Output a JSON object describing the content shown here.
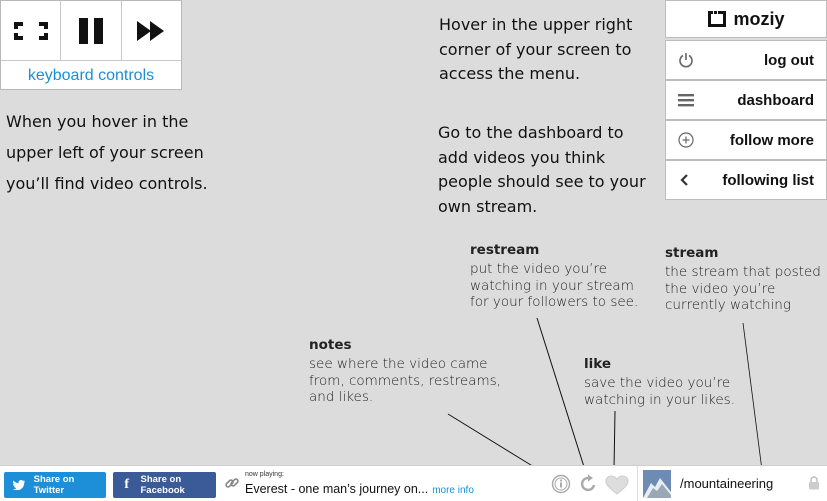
{
  "controls": {
    "keyboard_label": "keyboard controls",
    "fullscreen_icon": "fullscreen-icon",
    "pause_icon": "pause-icon",
    "next_icon": "fast-forward-icon"
  },
  "help": {
    "left_lines": [
      "When you hover in the",
      "upper left of your screen",
      "you’ll find video controls."
    ],
    "menu_lines": [
      "Hover in the upper right",
      "corner of your screen to",
      "access the menu."
    ],
    "dashboard_lines": [
      "Go to the dashboard to",
      "add videos you think",
      "people should see to your",
      "own stream."
    ]
  },
  "menu": {
    "logo_text": "moziy",
    "items": [
      {
        "label": "log out",
        "icon": "power-icon"
      },
      {
        "label": "dashboard",
        "icon": "hamburger-icon"
      },
      {
        "label": "follow more",
        "icon": "plus-circle-icon"
      },
      {
        "label": "following list",
        "icon": "chevron-left-icon"
      }
    ]
  },
  "annotations": {
    "restream": {
      "title": "restream",
      "lines": [
        "put the video you’re",
        "watching in your stream",
        "for your followers to see."
      ]
    },
    "stream": {
      "title": "stream",
      "lines": [
        "the stream that posted",
        "the video you’re",
        "currently watching"
      ]
    },
    "notes": {
      "title": "notes",
      "lines": [
        "see where the video came",
        "from, comments, restreams,",
        "and likes."
      ]
    },
    "like": {
      "title": "like",
      "lines": [
        "save the video you’re",
        "watching in your likes."
      ]
    }
  },
  "bottom": {
    "share_twitter": "Share on Twitter",
    "share_facebook": "Share on Facebook",
    "now_playing_label": "now playing:",
    "now_playing_title": "Everest - one man’s journey on...",
    "more_info": "more info",
    "stream_name": "/mountaineering"
  },
  "colors": {
    "accent_blue": "#1b8fd6",
    "twitter_blue": "#1d8fd8",
    "facebook_blue": "#3a5a98",
    "background": "#dcdcdc"
  }
}
